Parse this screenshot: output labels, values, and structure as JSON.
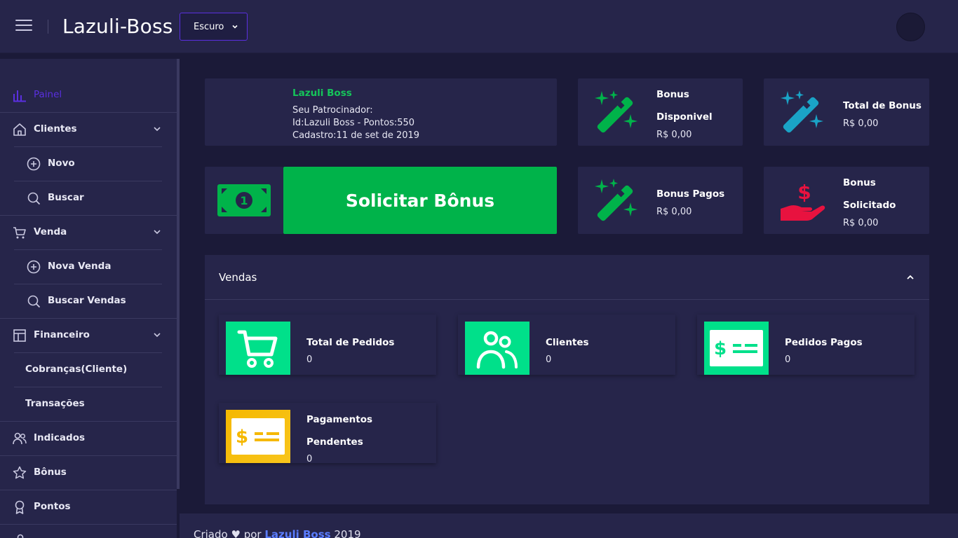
{
  "header": {
    "brand": "Lazuli-Boss",
    "theme_selected": "Escuro"
  },
  "sidebar": {
    "items": [
      {
        "label": "Painel",
        "icon": "chart-bars-icon",
        "active": true
      },
      {
        "label": "Clientes",
        "icon": "home-icon"
      },
      {
        "label": "Novo",
        "icon": "plus-circle-icon"
      },
      {
        "label": "Buscar",
        "icon": "search-icon"
      },
      {
        "label": "Venda",
        "icon": "cart-icon"
      },
      {
        "label": "Nova Venda",
        "icon": "plus-circle-icon"
      },
      {
        "label": "Buscar Vendas",
        "icon": "search-icon"
      },
      {
        "label": "Financeiro",
        "icon": "layout-icon"
      },
      {
        "label": "Cobranças(Cliente)"
      },
      {
        "label": "Transações"
      },
      {
        "label": "Indicados",
        "icon": "users-icon"
      },
      {
        "label": "Bônus",
        "icon": "star-icon"
      },
      {
        "label": "Pontos",
        "icon": "award-icon"
      }
    ]
  },
  "profile": {
    "name": "Lazuli Boss",
    "sponsor_label": "Seu Patrocinador:",
    "sponsor_info": "Id:Lazuli Boss - Pontos:550",
    "registered": "Cadastro:11 de set de 2019"
  },
  "bonus_cards": {
    "disponivel": {
      "title_1": "Bonus",
      "title_2": "Disponivel",
      "value": "R$ 0,00"
    },
    "total": {
      "title": "Total de Bonus",
      "value": "R$ 0,00"
    },
    "pagos": {
      "title": "Bonus Pagos",
      "value": "R$ 0,00"
    },
    "solicitado": {
      "title_1": "Bonus",
      "title_2": "Solicitado",
      "value": "R$ 0,00"
    }
  },
  "solicitar_button": "Solicitar Bônus",
  "vendas": {
    "title": "Vendas",
    "stats": [
      {
        "title": "Total de Pedidos",
        "value": "0",
        "icon": "cart-icon"
      },
      {
        "title": "Clientes",
        "value": "0",
        "icon": "users-icon"
      },
      {
        "title": "Pedidos Pagos",
        "value": "0",
        "icon": "dollar-card-icon"
      },
      {
        "title_1": "Pagamentos",
        "title_2": "Pendentes",
        "value": "0",
        "icon": "dollar-card-icon"
      }
    ]
  },
  "footer": {
    "prefix": "Criado",
    "by": "por",
    "link": "Lazuli Boss",
    "year": "2019"
  },
  "colors": {
    "accent": "#5a2fe0",
    "green": "#00b34a",
    "teal": "#00e08a",
    "cyan": "#1aa3c6",
    "red": "#e8123f",
    "yellow": "#f5b800"
  }
}
